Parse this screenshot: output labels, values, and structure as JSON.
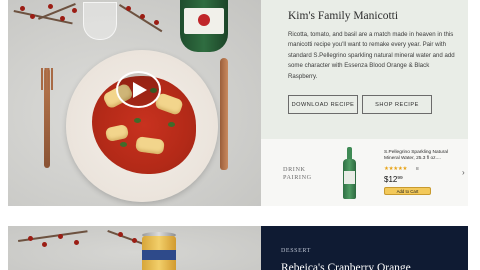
{
  "card1": {
    "title": "Kim's Family Manicotti",
    "description": "Ricotta, tomato, and basil are a match made in heaven in this manicotti recipe you'll want to remake every year. Pair with standard S.Pellegrino sparkling natural mineral water and add some character with Essenza Blood Orange & Black Raspberry.",
    "download_label": "DOWNLOAD RECIPE",
    "shop_label": "SHOP RECIPE",
    "pairing": {
      "label_line1": "DRINK",
      "label_line2": "PAIRING",
      "product_name": "S.Pellegrino Sparkling Natural Mineral Water, 25.3 fl oz....",
      "stars": "★★★★★",
      "rating_count": "8",
      "price_dollars": "$12",
      "price_cents": "99",
      "add_to_cart": "Add to Cart"
    }
  },
  "card2": {
    "category": "DESSERT",
    "title": "Rebeica's Cranberry Orange"
  },
  "colors": {
    "card1_panel": "#e9ede7",
    "card2_panel": "#0f1b33",
    "cart_button": "#f3c95a"
  }
}
